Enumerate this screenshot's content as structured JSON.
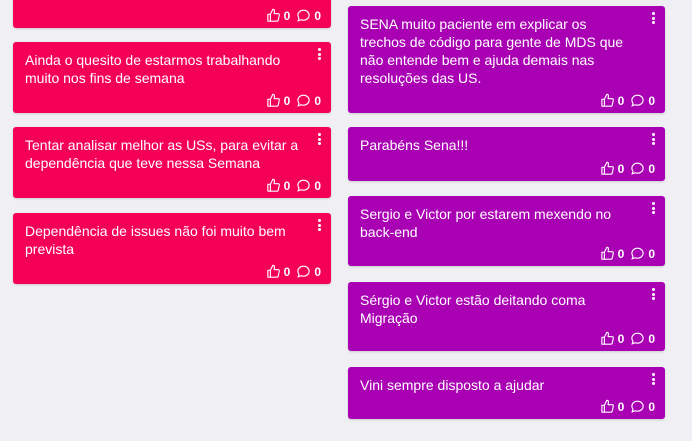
{
  "colors": {
    "negative": "#f50057",
    "positive": "#a900b4",
    "background": "#f0eff4"
  },
  "left_column": [
    {
      "text": "",
      "likes": "0",
      "comments": "0"
    },
    {
      "text": "Ainda o quesito de estarmos trabalhando muito nos fins de semana",
      "likes": "0",
      "comments": "0"
    },
    {
      "text": "Tentar analisar melhor as USs, para evitar a dependência que teve nessa Semana",
      "likes": "0",
      "comments": "0"
    },
    {
      "text": "Dependência de issues não foi muito bem prevista",
      "likes": "0",
      "comments": "0"
    }
  ],
  "right_column": [
    {
      "text": "SENA muito paciente em explicar os trechos de código para gente de MDS que não entende bem e ajuda demais nas resoluções das US.",
      "likes": "0",
      "comments": "0"
    },
    {
      "text": "Parabéns Sena!!!",
      "likes": "0",
      "comments": "0"
    },
    {
      "text": "Sergio e Victor por estarem mexendo no back-end",
      "likes": "0",
      "comments": "0"
    },
    {
      "text": "Sérgio e Victor estão deitando coma Migração",
      "likes": "0",
      "comments": "0"
    },
    {
      "text": "Vini sempre disposto a ajudar",
      "likes": "0",
      "comments": "0"
    }
  ]
}
